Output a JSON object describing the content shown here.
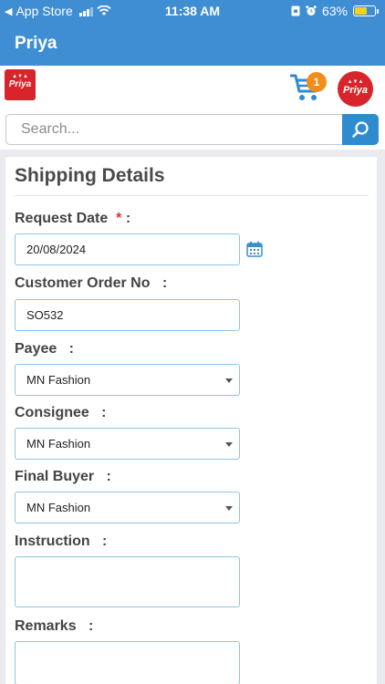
{
  "status_bar": {
    "back_label": "App Store",
    "time": "11:38 AM",
    "battery": "63%",
    "battery_level": 0.63
  },
  "app": {
    "title": "Priya"
  },
  "header": {
    "logo_text": "Priya",
    "cart_count": "1"
  },
  "search": {
    "placeholder": "Search..."
  },
  "form": {
    "title": "Shipping Details",
    "request_date": {
      "label": "Request Date",
      "required_mark": "*",
      "colon": ":",
      "value": "20/08/2024"
    },
    "customer_order": {
      "label": "Customer Order No",
      "colon": ":",
      "value": "SO532"
    },
    "payee": {
      "label": "Payee",
      "colon": ":",
      "value": "MN Fashion"
    },
    "consignee": {
      "label": "Consignee",
      "colon": ":",
      "value": "MN Fashion"
    },
    "final_buyer": {
      "label": "Final Buyer",
      "colon": ":",
      "value": "MN Fashion"
    },
    "instruction": {
      "label": "Instruction",
      "colon": ":",
      "value": ""
    },
    "remarks": {
      "label": "Remarks",
      "colon": ":",
      "value": ""
    }
  },
  "colors": {
    "primary": "#3f8ed3",
    "search_button": "#2f8bd0",
    "brand_red": "#d7252b",
    "badge": "#f28c1b",
    "field_border": "#8fc3e6"
  }
}
